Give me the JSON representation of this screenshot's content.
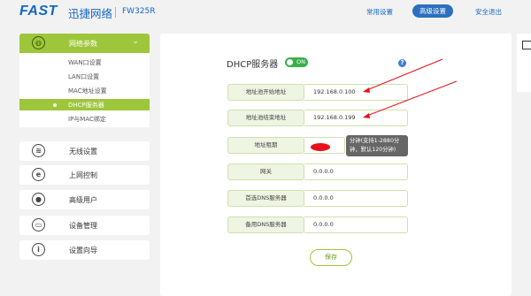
{
  "header": {
    "logo": "FAST",
    "brand": "迅捷网络",
    "model": "FW325R",
    "links": [
      {
        "label": "常用设置",
        "active": false
      },
      {
        "label": "高级设置",
        "active": true
      },
      {
        "label": "安全退出",
        "active": false
      }
    ]
  },
  "sidebar": {
    "network": {
      "label": "网络参数",
      "icon": "globe-icon",
      "expanded": true
    },
    "submenu": [
      {
        "label": "WAN口设置",
        "active": false
      },
      {
        "label": "LAN口设置",
        "active": false
      },
      {
        "label": "MAC地址设置",
        "active": false
      },
      {
        "label": "DHCP服务器",
        "active": true
      },
      {
        "label": "IP与MAC绑定",
        "active": false
      }
    ],
    "items": [
      {
        "label": "无线设置",
        "icon": "wifi-icon"
      },
      {
        "label": "上网控制",
        "icon": "e-icon"
      },
      {
        "label": "高级用户",
        "icon": "user-icon"
      },
      {
        "label": "设备管理",
        "icon": "router-icon"
      },
      {
        "label": "设置向导",
        "icon": "info-icon"
      }
    ]
  },
  "dhcp": {
    "title": "DHCP服务器",
    "toggle": "ON",
    "fields": [
      {
        "label": "地址池开始地址",
        "value": "192.168.0.100"
      },
      {
        "label": "地址池结束地址",
        "value": "192.168.0.199"
      },
      {
        "label": "地址租期",
        "value": ""
      },
      {
        "label": "网关",
        "value": "0.0.0.0"
      },
      {
        "label": "首选DNS服务器",
        "value": "0.0.0.0"
      },
      {
        "label": "备用DNS服务器",
        "value": "0.0.0.0"
      }
    ],
    "lease_tip": "分钟(支持1-2880分钟，默认120分钟)",
    "save": "保存"
  },
  "colors": {
    "brand": "#1467c3",
    "accent": "#9ec63a",
    "annotation": "#e8101a"
  }
}
